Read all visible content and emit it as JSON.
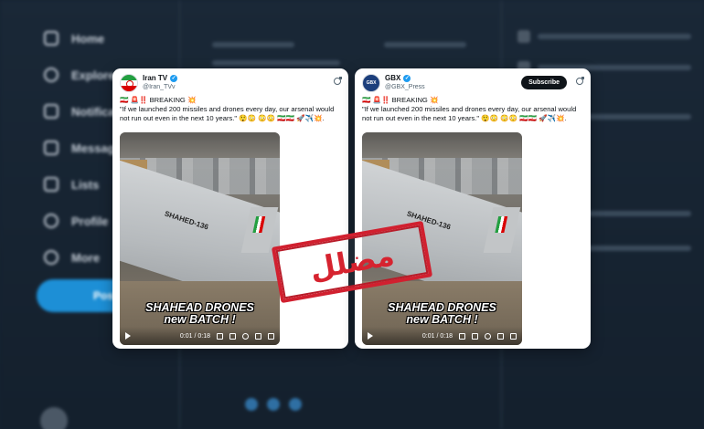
{
  "background": {
    "nav_items": [
      "Home",
      "Explore",
      "Notifications",
      "Messages",
      "Lists",
      "Profile",
      "More"
    ],
    "post_button": "Post"
  },
  "cards": [
    {
      "name": "Iran TV",
      "handle": "@Iran_TVv",
      "show_subscribe": false,
      "text_line1": "🇮🇷 🚨‼️ BREAKING 💥",
      "text_line2": "\"If we launched 200 missiles and drones every day, our arsenal would",
      "text_line3": "not run out even in the next 10 years.\" 😲😳 😳😳 🇮🇷🇮🇷 🚀✈️💥.",
      "video_caption_1": "SHAHEAD DRONES",
      "video_caption_2": "new BATCH !",
      "video_time": "0:01 / 0:18",
      "stencil_text": "SHAHED-136"
    },
    {
      "name": "GBX",
      "handle": "@GBX_Press",
      "avatar_text": "GBX",
      "show_subscribe": true,
      "subscribe_label": "Subscribe",
      "text_line1": "🇮🇷 🚨‼️ BREAKING 💥",
      "text_line2": "\"If we launched 200 missiles and drones every day, our arsenal would",
      "text_line3": "not run out even in the next 10 years.\" 😲😳 😳😳 🇮🇷🇮🇷 🚀✈️💥.",
      "video_caption_1": "SHAHEAD DRONES",
      "video_caption_2": "new BATCH !",
      "video_time": "0:01 / 0:18",
      "stencil_text": "SHAHED-136"
    }
  ],
  "stamp_text": "مضلل",
  "colors": {
    "stamp": "#d1202f",
    "verified": "#1d9bf0",
    "background": "#152231"
  }
}
